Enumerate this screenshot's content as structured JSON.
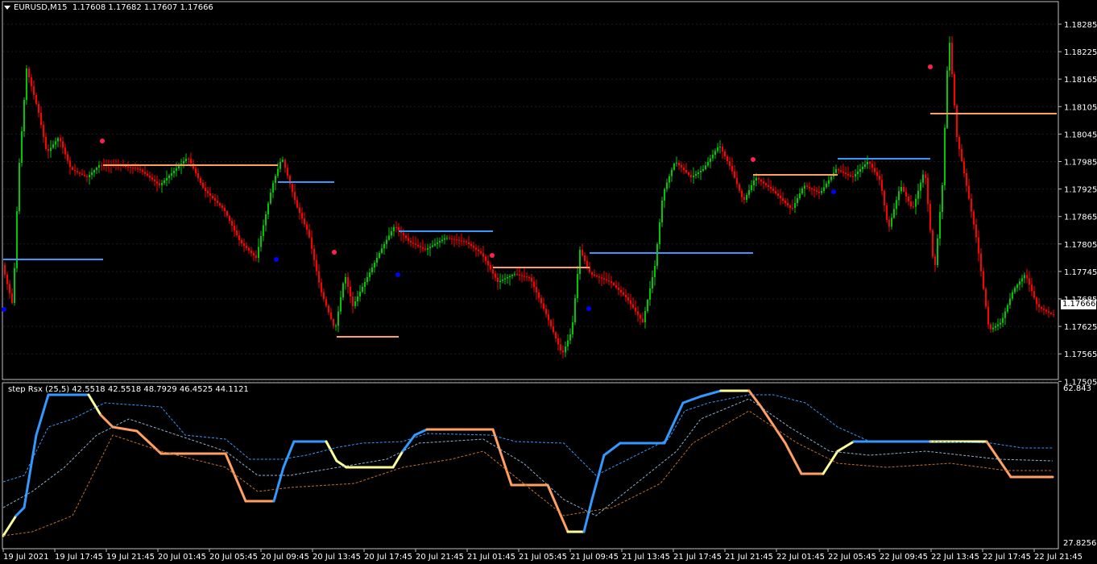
{
  "main_chart": {
    "symbol": "EURUSD,M15",
    "ohlc": "1.17608 1.17682 1.17607 1.17666",
    "current_price": "1.17666",
    "price_labels": [
      "1.18285",
      "1.18225",
      "1.18165",
      "1.18105",
      "1.18045",
      "1.17985",
      "1.17925",
      "1.17865",
      "1.17805",
      "1.17745",
      "1.17685",
      "1.17625",
      "1.17565",
      "1.17505"
    ],
    "colors": {
      "bull": "#00c800",
      "bear": "#ff0000",
      "level_up": "#3399ff",
      "level_down": "#ffa060",
      "dot_up": "#0000ff",
      "dot_down": "#ff2050"
    }
  },
  "indicator": {
    "title": "step Rsx (25,5) 42.5518 42.5518 48.7929 46.4525 44.1121",
    "scale_top": "62.843",
    "scale_bottom": "27.8256",
    "colors": {
      "up": "#3399ff",
      "down": "#ffa060",
      "flat": "#ffff99"
    }
  },
  "time_axis": [
    "19 Jul 2021",
    "19 Jul 17:45",
    "19 Jul 21:45",
    "20 Jul 01:45",
    "20 Jul 05:45",
    "20 Jul 09:45",
    "20 Jul 13:45",
    "20 Jul 17:45",
    "20 Jul 21:45",
    "21 Jul 01:45",
    "21 Jul 05:45",
    "21 Jul 09:45",
    "21 Jul 13:45",
    "21 Jul 17:45",
    "21 Jul 21:45",
    "22 Jul 01:45",
    "22 Jul 05:45",
    "22 Jul 09:45",
    "22 Jul 13:45",
    "22 Jul 17:45",
    "22 Jul 21:45"
  ]
}
